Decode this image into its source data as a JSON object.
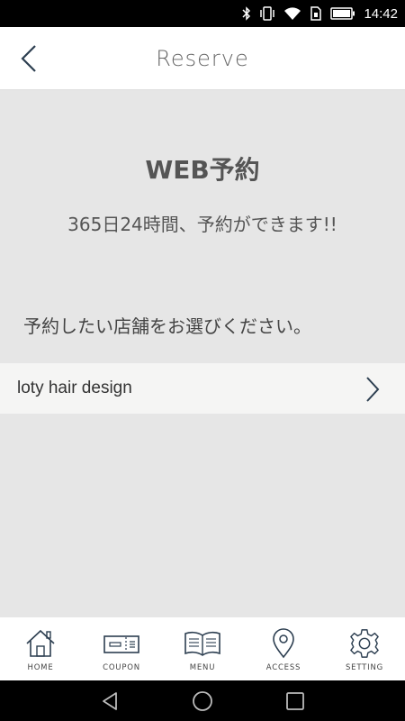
{
  "status_bar": {
    "time": "14:42",
    "icons": [
      "bluetooth-icon",
      "vibrate-icon",
      "wifi-icon",
      "sim-icon",
      "battery-icon"
    ]
  },
  "header": {
    "title": "Reserve",
    "back_icon": "chevron-left-icon"
  },
  "main": {
    "title": "WEB予約",
    "subtitle": "365日24時間、予約ができます!!",
    "select_label": "予約したい店舗をお選びください。",
    "shops": [
      {
        "name": "loty hair design",
        "icon": "chevron-right-icon"
      }
    ]
  },
  "tabbar": {
    "tabs": [
      {
        "label": "HOME",
        "icon": "home-icon"
      },
      {
        "label": "COUPON",
        "icon": "coupon-icon"
      },
      {
        "label": "MENU",
        "icon": "book-icon"
      },
      {
        "label": "ACCESS",
        "icon": "map-pin-icon"
      },
      {
        "label": "SETTING",
        "icon": "gear-icon"
      }
    ]
  },
  "nav_bar": {
    "buttons": [
      "back-triangle-icon",
      "home-circle-icon",
      "recents-square-icon"
    ]
  },
  "colors": {
    "background": "#e6e6e6",
    "header_bg": "#ffffff",
    "row_bg": "#f5f5f4",
    "text": "#555555",
    "icon_blue": "#2c3e50"
  }
}
